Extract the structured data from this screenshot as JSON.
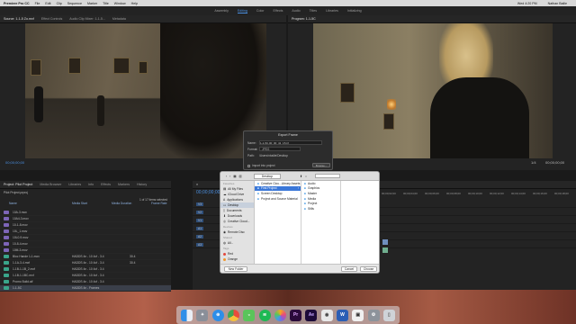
{
  "menubar": {
    "apple": "",
    "app_name": "Premiere Pro CC",
    "items": [
      "File",
      "Edit",
      "Clip",
      "Sequence",
      "Marker",
      "Title",
      "Window",
      "Help"
    ],
    "clock": "Wed 4:20 PM",
    "user": "Nathan Bailie"
  },
  "workspaces": {
    "items": [
      "Assembly",
      "Editing",
      "Color",
      "Effects",
      "Audio",
      "Titles",
      "Libraries",
      "Initializing"
    ],
    "active": "Editing"
  },
  "source_panel": {
    "tabs": [
      "Source: 1-1-5 Zo.mxf",
      "Effect Controls",
      "Audio Clip Mixer: 1-1-5...",
      "Metadata"
    ],
    "timecode": "00;00;00;00"
  },
  "program_panel": {
    "tab": "Program: 1-1-5C",
    "timecode": "00;00;41;15",
    "duration": "1/4",
    "end_timecode": "00;00;00;00"
  },
  "project_panel": {
    "tabs": [
      "Project: Pilot Project",
      "Media Browser",
      "Libraries",
      "Info",
      "Effects",
      "Markers",
      "History"
    ],
    "project_file": "Pilot Project.prproj",
    "item_count": "1 of 17 items selected",
    "columns": [
      "Name",
      "Media Start",
      "Media Duration",
      "Frame Rate"
    ],
    "rows": [
      {
        "name": "10A-3.mov",
        "color": "#7d65b8",
        "start": "",
        "dur": ""
      },
      {
        "name": "10A4-3.mov",
        "color": "#7d65b8",
        "start": "",
        "dur": ""
      },
      {
        "name": "10-1-8.mov",
        "color": "#7d65b8",
        "start": "",
        "dur": ""
      },
      {
        "name": "10L_1.mov",
        "color": "#7d65b8",
        "start": "",
        "dur": ""
      },
      {
        "name": "10L0-9.mov",
        "color": "#7d65b8",
        "start": "",
        "dur": ""
      },
      {
        "name": "10-8-4.mov",
        "color": "#7d65b8",
        "start": "",
        "dur": ""
      },
      {
        "name": "10M-3.mov",
        "color": "#7d65b8",
        "start": "",
        "dur": ""
      },
      {
        "name": "Bloc Hande 1-1.mov",
        "color": "#3aa58a",
        "start": "HADDS 4n - 10 4cf - 3.4",
        "dur": "30.4"
      },
      {
        "name": "1-1A-3-4.mxf",
        "color": "#3aa58a",
        "start": "HADDS 4n - 10 4cf - 3.4",
        "dur": "30.4"
      },
      {
        "name": "1-1B-1-1B_2.mxf",
        "color": "#3aa58a",
        "start": "HADDS 4n - 10 4cf - 3.4",
        "dur": ""
      },
      {
        "name": "1-1B-1-1BC.mxf",
        "color": "#3aa58a",
        "start": "HADDS 4n - 10 4cf - 3.4",
        "dur": ""
      },
      {
        "name": "Promo Build.aif",
        "color": "#3aa58a",
        "start": "HADDS 4n - 10 4cf - 3.4",
        "dur": ""
      },
      {
        "name": "1-1-5C",
        "color": "#3aa58a",
        "start": "HADDS 4n - Frames",
        "dur": ""
      }
    ]
  },
  "timeline": {
    "timecode": "00;00;00;00",
    "ruler": [
      "00;00;02;00",
      "00;00;04;00",
      "00;00;06;00",
      "00;00;08;00",
      "00;00;10;00",
      "00;00;12;00",
      "00;00;14;00",
      "00;00;16;00",
      "00;00;18;00"
    ],
    "tracks": [
      "V3",
      "V2",
      "V1",
      "A1",
      "A2",
      "A3"
    ]
  },
  "export_dialog": {
    "title": "Export Frame",
    "name_label": "Name:",
    "name_value": "1-1-5C.00_00_41_15.tif",
    "format_label": "Format:",
    "format_value": "JPEG",
    "path_label": "Path:",
    "path_value": "/Users/nbailie/Desktop",
    "import_label": "Import into project",
    "browse_label": "Browse..."
  },
  "finder": {
    "location": "Desktop",
    "sidebar": {
      "favorites_header": "Favorites",
      "favorites": [
        "Creative Clou...Library Assets",
        "All My Files",
        "iCloud Drive",
        "Applications",
        "Desktop",
        "Documents",
        "Downloads",
        "Creative Cloud..."
      ],
      "devices_header": "Devices",
      "devices": [
        "Remote Disc"
      ],
      "shared_header": "Shared",
      "shared": [
        "All..."
      ],
      "tags_header": "Tags",
      "tags": [
        {
          "label": "Red",
          "color": "#e2473d"
        },
        {
          "label": "Orange",
          "color": "#f0962c"
        }
      ],
      "selected": "Desktop"
    },
    "col1": [
      "Creative Clou...Library Assets",
      "First Project",
      "Screen Desktop",
      "Project and Source Material"
    ],
    "col1_selected": "First Project",
    "col2": [
      "Audio",
      "Graphics",
      "Master",
      "Media",
      "Project",
      "Stills"
    ],
    "new_folder": "New Folder",
    "cancel": "Cancel",
    "choose": "Choose"
  },
  "dock": {
    "icons": [
      "finder-icon",
      "launchpad-icon",
      "safari-icon",
      "chrome-icon",
      "messages-icon",
      "spotify-icon",
      "photos-icon",
      "premiere-icon",
      "after-effects-icon",
      "illustrator-icon",
      "word-icon",
      "preview-icon",
      "system-preferences-icon",
      "trash-icon"
    ]
  }
}
